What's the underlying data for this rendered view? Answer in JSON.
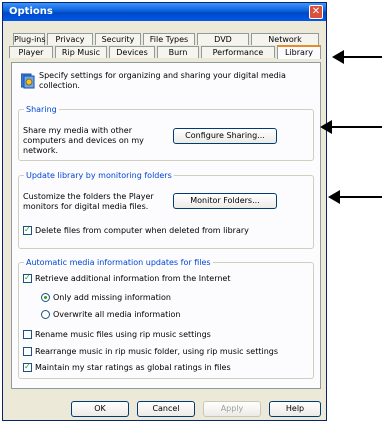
{
  "window": {
    "title": "Options"
  },
  "tabs": {
    "row1": [
      "Plug-ins",
      "Privacy",
      "Security",
      "File Types",
      "DVD",
      "Network"
    ],
    "row2": [
      "Player",
      "Rip Music",
      "Devices",
      "Burn",
      "Performance",
      "Library"
    ],
    "active": "Library"
  },
  "library": {
    "description": "Specify settings for organizing and sharing your digital media collection.",
    "sharing": {
      "title": "Sharing",
      "text": "Share my media with other computers and devices on my network.",
      "button": "Configure Sharing..."
    },
    "monitor": {
      "title": "Update library by monitoring folders",
      "text": "Customize the folders the Player monitors for digital media files.",
      "button": "Monitor Folders...",
      "delete_label": "Delete files from computer when deleted from library",
      "delete_checked": true
    },
    "auto_update": {
      "title": "Automatic media information updates for files",
      "retrieve_label": "Retrieve additional information from the Internet",
      "retrieve_checked": true,
      "radio_only_missing": "Only add missing information",
      "radio_overwrite": "Overwrite all media information",
      "selected_radio": "Only add missing information",
      "rename_label": "Rename music files using rip music settings",
      "rename_checked": false,
      "rearrange_label": "Rearrange music in rip music folder, using rip music settings",
      "rearrange_checked": false,
      "ratings_label": "Maintain my star ratings as global ratings in files",
      "ratings_checked": true
    }
  },
  "buttons": {
    "ok": "OK",
    "cancel": "Cancel",
    "apply": "Apply",
    "help": "Help"
  },
  "colors": {
    "title_bar": "#0058e8",
    "section_title": "#0046d5",
    "active_tab_accent": "#e68b2c",
    "close_button": "#d9503c"
  }
}
